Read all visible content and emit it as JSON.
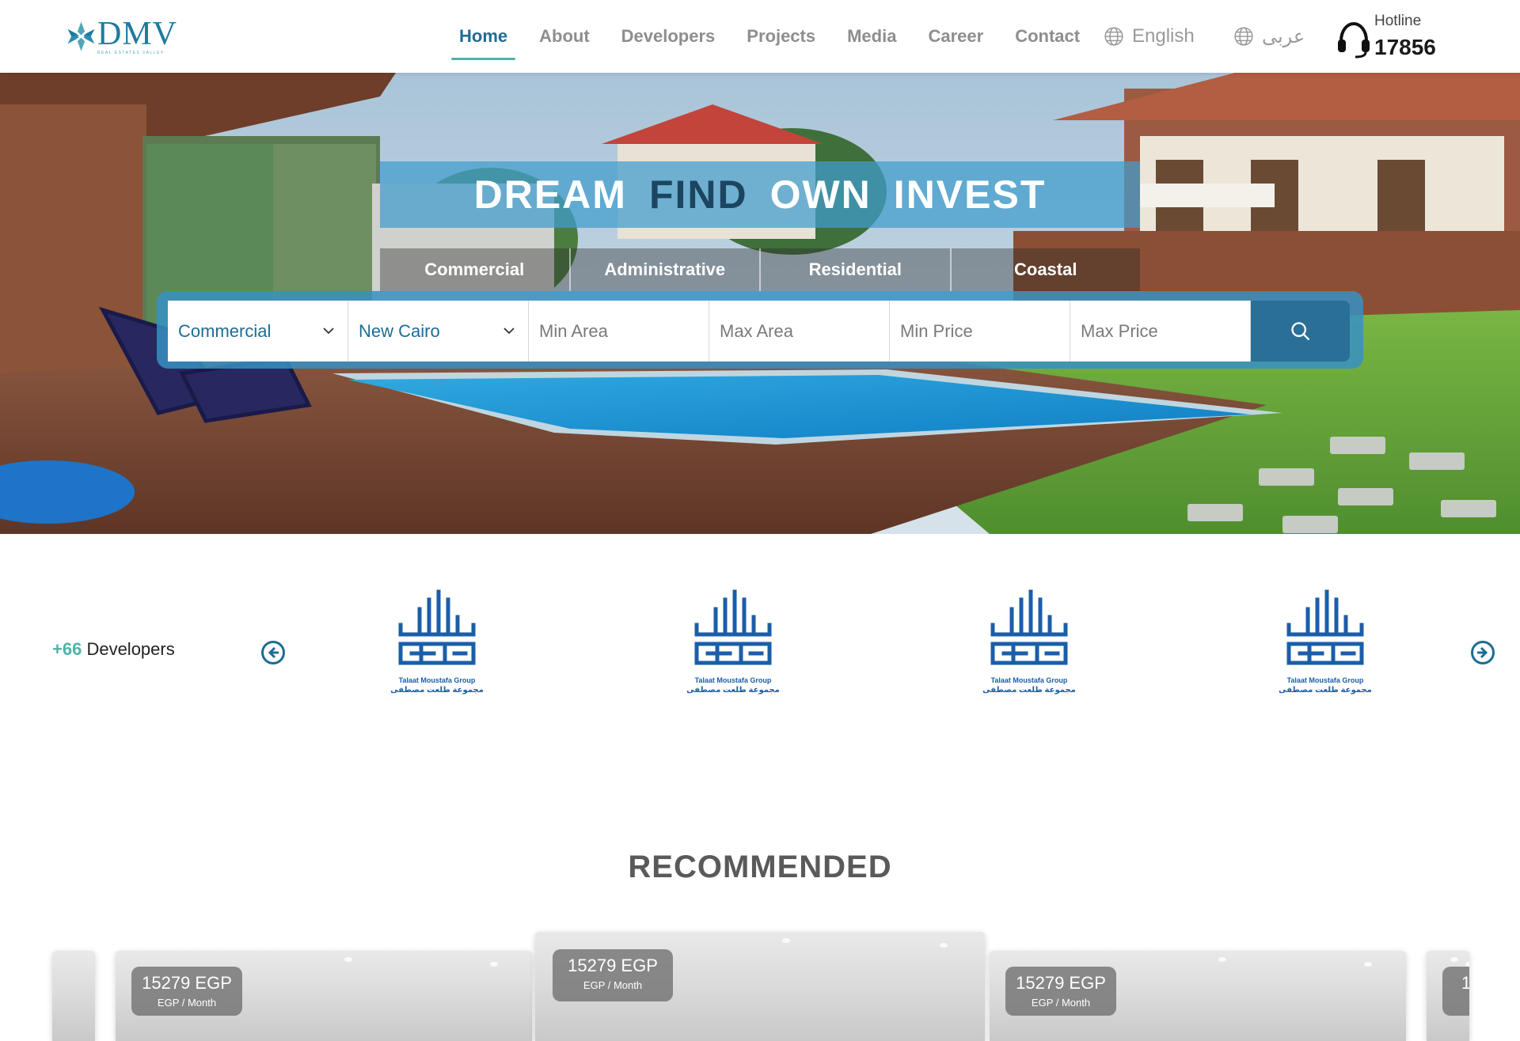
{
  "header": {
    "logo": {
      "name": "DMV",
      "tagline": "REAL ESTATES VALLEY"
    },
    "nav": [
      {
        "label": "Home",
        "active": true
      },
      {
        "label": "About",
        "active": false
      },
      {
        "label": "Developers",
        "active": false
      },
      {
        "label": "Projects",
        "active": false
      },
      {
        "label": "Media",
        "active": false
      },
      {
        "label": "Career",
        "active": false
      },
      {
        "label": "Contact",
        "active": false
      }
    ],
    "languages": {
      "english": "English",
      "arabic": "عربى"
    },
    "hotline": {
      "label": "Hotline",
      "number": "17856"
    }
  },
  "hero": {
    "headline": [
      {
        "word": "DREAM",
        "style": "light"
      },
      {
        "word": "FIND",
        "style": "dark"
      },
      {
        "word": "OWN",
        "style": "light"
      },
      {
        "word": "INVEST",
        "style": "light"
      }
    ],
    "categories": [
      "Commercial",
      "Administrative",
      "Residential",
      "Coastal"
    ],
    "search": {
      "type_value": "Commercial",
      "location_value": "New Cairo",
      "min_area_placeholder": "Min Area",
      "max_area_placeholder": "Max Area",
      "min_price_placeholder": "Min Price",
      "max_price_placeholder": "Max Price"
    }
  },
  "developers": {
    "count": "+66",
    "label": "Developers",
    "logos": [
      {
        "name_en": "Talaat Moustafa Group",
        "name_ar": "مجموعة طلعت مصطفى"
      },
      {
        "name_en": "Talaat Moustafa Group",
        "name_ar": "مجموعة طلعت مصطفى"
      },
      {
        "name_en": "Talaat Moustafa Group",
        "name_ar": "مجموعة طلعت مصطفى"
      },
      {
        "name_en": "Talaat Moustafa Group",
        "name_ar": "مجموعة طلعت مصطفى"
      }
    ]
  },
  "recommended": {
    "title": "RECOMMENDED",
    "cards": [
      {
        "price": "15279 EGP",
        "period": "EGP / Month"
      },
      {
        "price": "15279 EGP",
        "period": "EGP / Month"
      },
      {
        "price": "15279 EGP",
        "period": "EGP / Month"
      },
      {
        "price": "1",
        "period": ""
      }
    ]
  },
  "colors": {
    "brand": "#1f6c93",
    "accent": "#4fb3a8",
    "search_band": "#3791c3"
  },
  "icons": [
    "globe-icon",
    "headset-icon",
    "chevron-down-icon",
    "search-icon",
    "arrow-left-circle-icon",
    "arrow-right-circle-icon"
  ]
}
